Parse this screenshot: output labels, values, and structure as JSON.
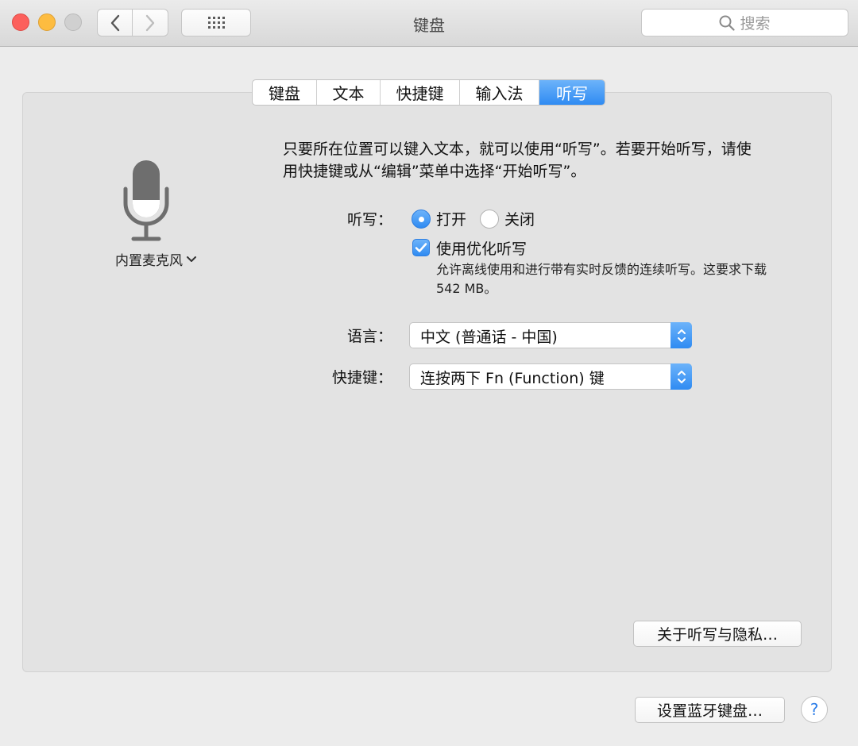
{
  "window": {
    "title": "键盘",
    "search_placeholder": "搜索"
  },
  "tabs": [
    {
      "label": "键盘",
      "active": false
    },
    {
      "label": "文本",
      "active": false
    },
    {
      "label": "快捷键",
      "active": false
    },
    {
      "label": "输入法",
      "active": false
    },
    {
      "label": "听写",
      "active": true
    }
  ],
  "microphone": {
    "icon": "microphone-icon",
    "source_label": "内置麦克风"
  },
  "description": "只要所在位置可以键入文本，就可以使用“听写”。若要开始听写，请使用快捷键或从“编辑”菜单中选择“开始听写”。",
  "dictation": {
    "label": "听写：",
    "on_label": "打开",
    "off_label": "关闭",
    "selected": "打开",
    "enhanced_label": "使用优化听写",
    "enhanced_checked": true,
    "enhanced_note": "允许离线使用和进行带有实时反馈的连续听写。这要求下载 542 MB。"
  },
  "language": {
    "label": "语言：",
    "value": "中文 (普通话 - 中国)"
  },
  "shortcut": {
    "label": "快捷键：",
    "value": "连按两下 Fn (Function) 键"
  },
  "buttons": {
    "privacy": "关于听写与隐私…",
    "bluetooth": "设置蓝牙键盘…",
    "help": "?"
  },
  "colors": {
    "accent": "#3a8ff5",
    "traffic_red": "#fc605c",
    "traffic_yellow": "#fdbc40",
    "traffic_inactive": "#d0d0d0"
  }
}
